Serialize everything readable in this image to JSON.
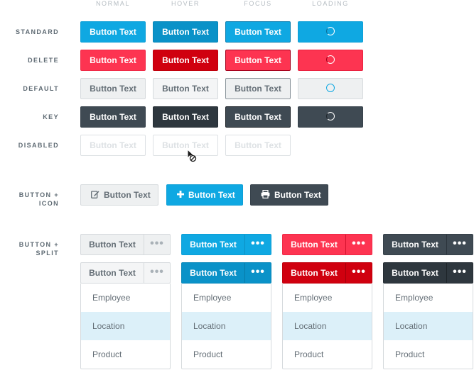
{
  "columns": [
    "NORMAL",
    "HOVER",
    "FOCUS",
    "LOADING"
  ],
  "rows": {
    "standard": "STANDARD",
    "delete": "DELETE",
    "default": "DEFAULT",
    "key": "KEY",
    "disabled": "DISABLED",
    "button_icon": "BUTTON + ICON",
    "button_split": "BUTTON + SPLIT"
  },
  "button_label": "Button Text",
  "split_more_label": "•••",
  "icons": {
    "loading": "spinner-icon",
    "cursor": "not-allowed-cursor-icon",
    "edit": "pencil-icon",
    "add": "plus-icon",
    "print": "printer-icon",
    "more": "ellipsis-icon"
  },
  "dropdown_items": [
    "Employee",
    "Location",
    "Product"
  ],
  "dropdown_active_item": "Location",
  "colors": {
    "standard": "#0fa8e2",
    "delete": "#fd3451",
    "default": "#eef0f1",
    "key": "#3f4a53",
    "disabled_border": "#dde1e4",
    "dropdown_active": "#dcf0f9"
  }
}
